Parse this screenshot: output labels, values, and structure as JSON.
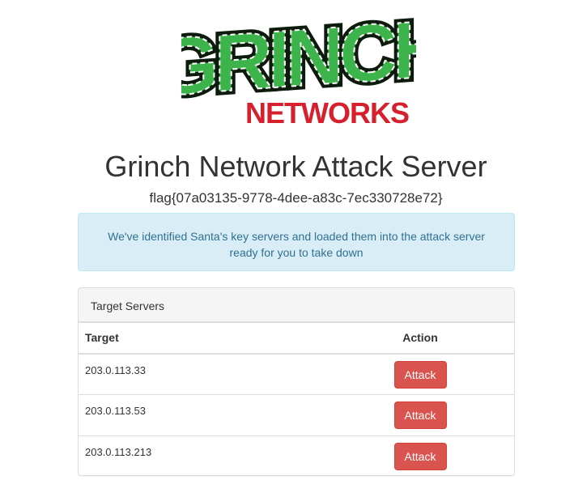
{
  "logo": {
    "word_top": "GRINCH",
    "word_bottom": "NETWORKS",
    "colors": {
      "green": "#3cb44b",
      "dark": "#0d1b0d",
      "red": "#d6202d"
    }
  },
  "header": {
    "title": "Grinch Network Attack Server",
    "flag": "flag{07a03135-9778-4dee-a83c-7ec330728e72}"
  },
  "alert": {
    "message": "We've identified Santa's key servers and loaded them into the attack server ready for you to take down"
  },
  "panel": {
    "heading": "Target Servers",
    "columns": {
      "target": "Target",
      "action": "Action"
    },
    "rows": [
      {
        "target": "203.0.113.33",
        "action_label": "Attack"
      },
      {
        "target": "203.0.113.53",
        "action_label": "Attack"
      },
      {
        "target": "203.0.113.213",
        "action_label": "Attack"
      }
    ]
  },
  "colors": {
    "danger": "#d9534f",
    "info_bg": "#d9edf7",
    "info_text": "#31708f"
  }
}
